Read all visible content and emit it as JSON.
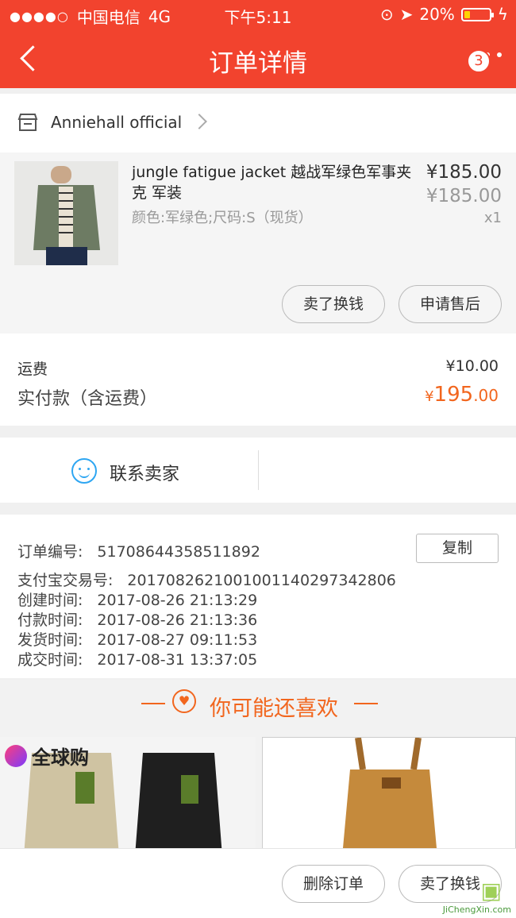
{
  "status_bar": {
    "carrier": "中国电信",
    "network": "4G",
    "time": "下午5:11",
    "battery": "20%"
  },
  "nav": {
    "title": "订单详情",
    "badge_count": "3"
  },
  "shop": {
    "name": "Anniehall official"
  },
  "product": {
    "title": "jungle fatigue jacket 越战军绿色军事夹克 军装",
    "sku": "颜色:军绿色;尺码:S（现货）",
    "price": "¥185.00",
    "original_price": "¥185.00",
    "quantity": "x1",
    "sell_button": "卖了换钱",
    "aftersale_button": "申请售后"
  },
  "fees": {
    "shipping_label": "运费",
    "shipping_value": "¥10.00",
    "paid_label": "实付款（含运费）",
    "paid_currency": "¥",
    "paid_integer": "195",
    "paid_decimal": ".00"
  },
  "contact": {
    "label": "联系卖家"
  },
  "order_info": {
    "order_no_label": "订单编号:",
    "order_no": "51708644358511892",
    "copy_button": "复制",
    "alipay_label": "支付宝交易号:",
    "alipay_no": "2017082621001001140297342806",
    "created_label": "创建时间:",
    "created": "2017-08-26 21:13:29",
    "paid_label": "付款时间:",
    "paid": "2017-08-26 21:13:36",
    "shipped_label": "发货时间:",
    "shipped": "2017-08-27 09:11:53",
    "closed_label": "成交时间:",
    "closed": "2017-08-31 13:37:05"
  },
  "recommend": {
    "title": "你可能还喜欢",
    "global_tag": "全球购"
  },
  "bottom_bar": {
    "delete_button": "删除订单",
    "sell_button": "卖了换钱"
  },
  "watermark": {
    "text": "JiChengXin.com"
  },
  "colors": {
    "header": "#f2432e",
    "accent": "#f2661e",
    "contact": "#2ea6f2"
  }
}
